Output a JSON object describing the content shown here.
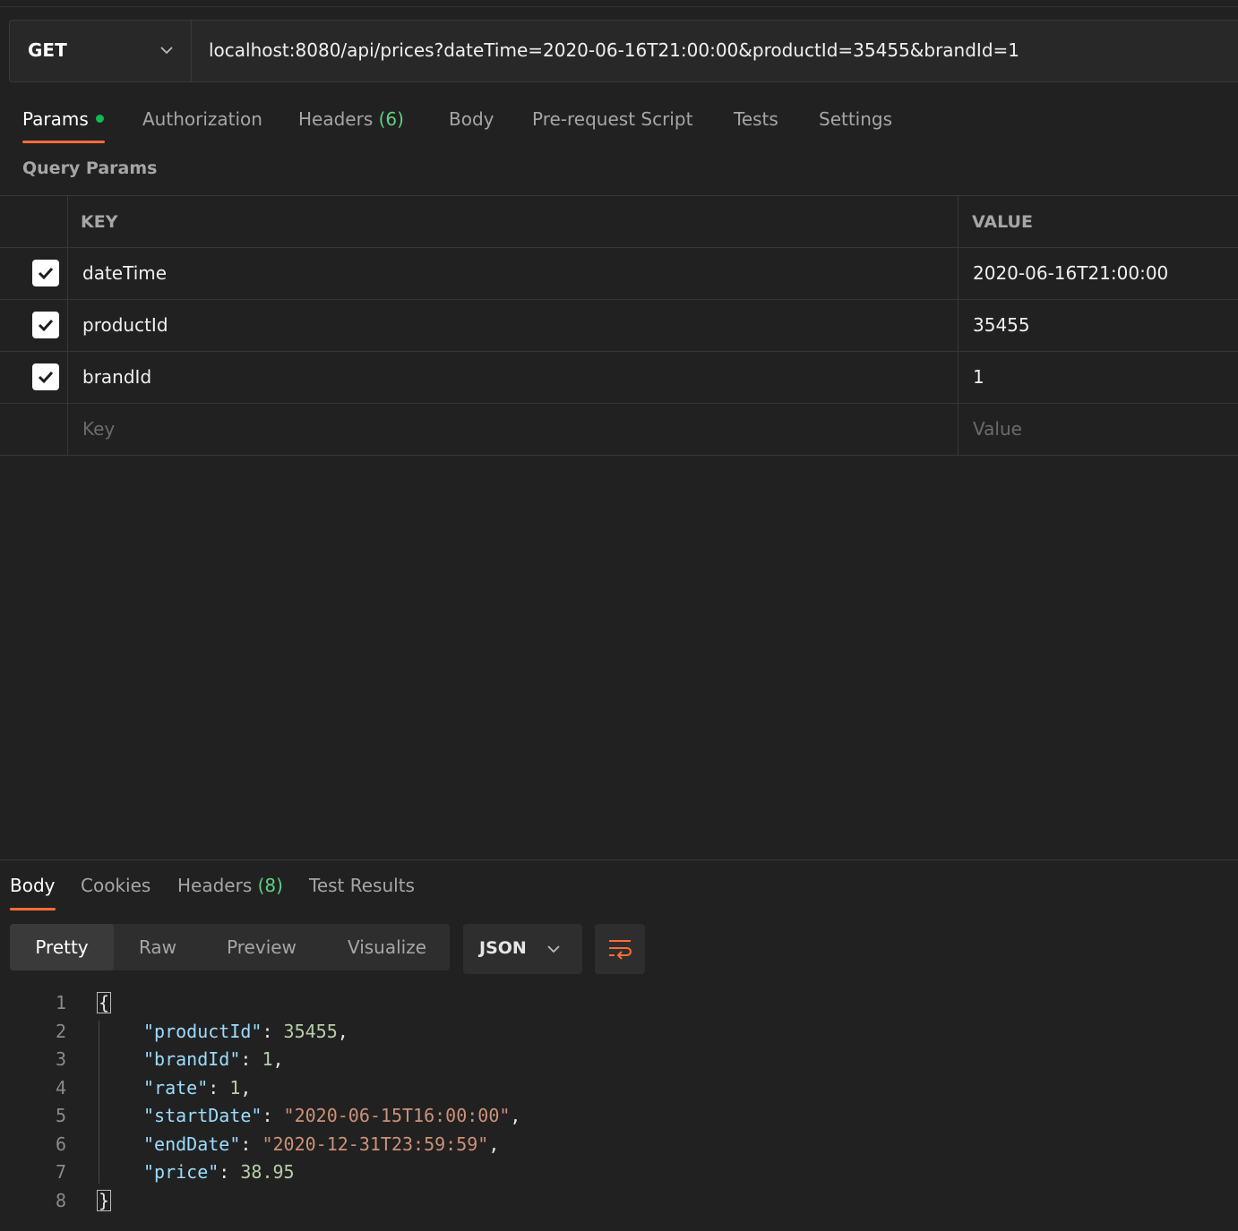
{
  "request": {
    "method": "GET",
    "url": "localhost:8080/api/prices?dateTime=2020-06-16T21:00:00&productId=35455&brandId=1"
  },
  "request_tabs": {
    "params": "Params",
    "authorization": "Authorization",
    "headers": "Headers",
    "headers_count": "(6)",
    "body": "Body",
    "prerequest": "Pre-request Script",
    "tests": "Tests",
    "settings": "Settings"
  },
  "query_params": {
    "title": "Query Params",
    "key_header": "KEY",
    "value_header": "VALUE",
    "rows": [
      {
        "key": "dateTime",
        "value": "2020-06-16T21:00:00"
      },
      {
        "key": "productId",
        "value": "35455"
      },
      {
        "key": "brandId",
        "value": "1"
      }
    ],
    "key_placeholder": "Key",
    "value_placeholder": "Value"
  },
  "response_tabs": {
    "body": "Body",
    "cookies": "Cookies",
    "headers": "Headers",
    "headers_count": "(8)",
    "test_results": "Test Results"
  },
  "view_modes": {
    "pretty": "Pretty",
    "raw": "Raw",
    "preview": "Preview",
    "visualize": "Visualize"
  },
  "format": "JSON",
  "response_json": {
    "line_numbers": [
      "1",
      "2",
      "3",
      "4",
      "5",
      "6",
      "7",
      "8"
    ],
    "open_brace": "{",
    "close_brace": "}",
    "fields": [
      {
        "key": "\"productId\"",
        "value": "35455",
        "comma": ","
      },
      {
        "key": "\"brandId\"",
        "value": "1",
        "comma": ","
      },
      {
        "key": "\"rate\"",
        "value": "1",
        "comma": ","
      },
      {
        "key": "\"startDate\"",
        "value": "\"2020-06-15T16:00:00\"",
        "comma": ","
      },
      {
        "key": "\"endDate\"",
        "value": "\"2020-12-31T23:59:59\"",
        "comma": ","
      },
      {
        "key": "\"price\"",
        "value": "38.95",
        "comma": ""
      }
    ]
  },
  "colors": {
    "accent": "#ff6c37",
    "status_dot": "#0cbb52",
    "count_green": "#5fd085",
    "json_key": "#9cdcfe",
    "json_number": "#b5cea8",
    "json_string": "#ce9178"
  }
}
